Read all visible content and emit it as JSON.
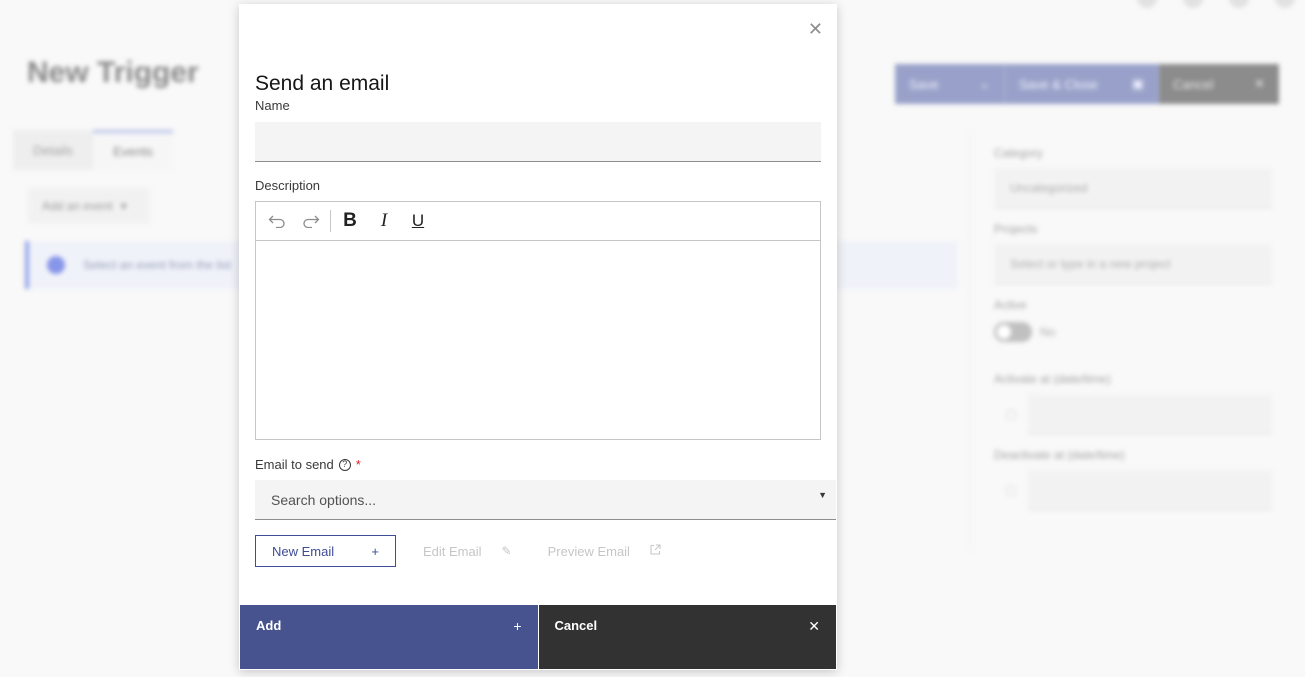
{
  "background": {
    "title": "New Trigger",
    "tabs": [
      {
        "label": "Details"
      },
      {
        "label": "Events"
      }
    ],
    "add_event_label": "Add an event",
    "info_text": "Select an event from the list",
    "actions": [
      {
        "label": "Save",
        "icon": "chevron-down-icon"
      },
      {
        "label": "Save & Close",
        "icon": "save-icon"
      },
      {
        "label": "Cancel",
        "icon": "close-icon"
      }
    ],
    "sidebar": {
      "category_label": "Category",
      "category_value": "Uncategorized",
      "projects_label": "Projects",
      "projects_placeholder": "Select or type in a new project",
      "active_label": "Active",
      "active_value": "No",
      "activate_label": "Activate at (date/time)",
      "deactivate_label": "Deactivate at (date/time)"
    }
  },
  "modal": {
    "title": "Send an email",
    "close_icon": "close-icon",
    "name_label": "Name",
    "name_value": "",
    "description_label": "Description",
    "toolbar": {
      "undo": "↶",
      "redo": "↷",
      "bold": "B",
      "italic": "I",
      "underline": "U"
    },
    "email_label": "Email to send",
    "email_required": "*",
    "email_placeholder": "Search options...",
    "new_email_label": "New Email",
    "edit_email_label": "Edit Email",
    "preview_email_label": "Preview Email",
    "add_label": "Add",
    "cancel_label": "Cancel"
  },
  "colors": {
    "primary": "#46538e",
    "dark": "#323232",
    "required": "#da1e28"
  }
}
